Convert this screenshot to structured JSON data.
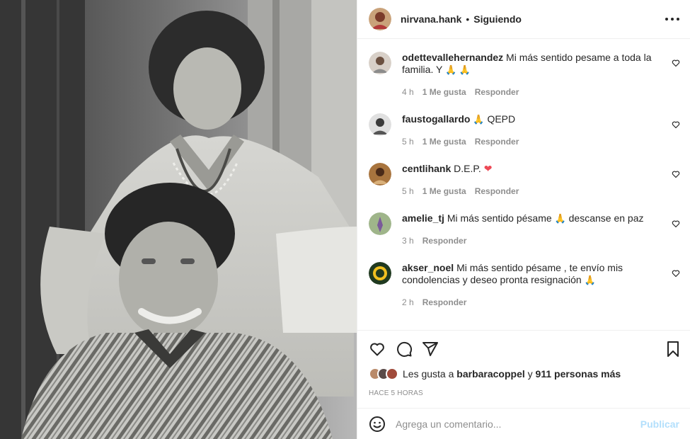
{
  "post": {
    "author": "nirvana.hank",
    "dot": "•",
    "follow_status": "Siguiendo"
  },
  "comments": [
    {
      "user": "odettevallehernandez",
      "text": "Mi más sentido pesame a toda la familia. Y",
      "emoji": "🙏 🙏",
      "time": "4 h",
      "likes": "1 Me gusta",
      "reply": "Responder"
    },
    {
      "user": "faustogallardo",
      "emoji_before": "🙏",
      "text": "QEPD",
      "time": "5 h",
      "likes": "1 Me gusta",
      "reply": "Responder"
    },
    {
      "user": "centlihank",
      "text": "D.E.P.",
      "emoji": "❤",
      "time": "5 h",
      "likes": "1 Me gusta",
      "reply": "Responder"
    },
    {
      "user": "amelie_tj",
      "text": "Mi más sentido pésame",
      "emoji": "🙏",
      "text_after": "descanse en paz",
      "time": "3 h",
      "reply": "Responder"
    },
    {
      "user": "akser_noel",
      "text": "Mi más sentido pésame , te envío mis condolencias y deseo pronta resignación",
      "emoji": "🙏",
      "time": "2 h",
      "reply": "Responder"
    }
  ],
  "likes": {
    "prefix": "Les gusta a",
    "user": "barbaracoppel",
    "conj": "y",
    "others": "911 personas más"
  },
  "timestamp": "HACE 5 HORAS",
  "add_comment": {
    "placeholder": "Agrega un comentario...",
    "post_label": "Publicar"
  },
  "icons": {
    "like": "heart-icon",
    "comment": "comment-icon",
    "share": "share-icon",
    "save": "bookmark-icon",
    "emoji": "emoji-icon",
    "more": "more-options-icon"
  },
  "colors": {
    "link_disabled": "#b2dffc",
    "secondary_text": "#8e8e8e",
    "heart_red": "#ed4956"
  }
}
